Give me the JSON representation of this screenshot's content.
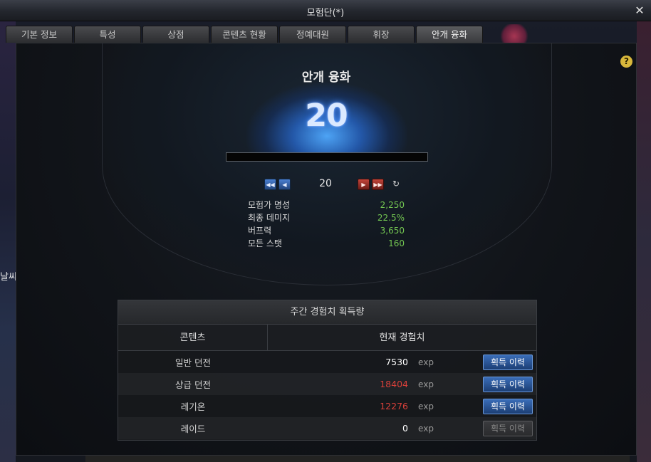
{
  "window": {
    "title": "모험단(*)",
    "close_icon": "close-icon"
  },
  "tabs": [
    {
      "label": "기본 정보",
      "active": false
    },
    {
      "label": "특성",
      "active": false
    },
    {
      "label": "상점",
      "active": false
    },
    {
      "label": "콘텐츠 현황",
      "active": false
    },
    {
      "label": "정예대원",
      "active": false
    },
    {
      "label": "휘장",
      "active": false
    },
    {
      "label": "안개 융화",
      "active": true
    }
  ],
  "help": {
    "icon": "help-icon",
    "label": "?"
  },
  "fusion": {
    "title": "안개 융화",
    "level": "20",
    "progress_fraction": 0.0,
    "nav_level": "20"
  },
  "nav_buttons": {
    "first": "◀◀",
    "prev": "◀",
    "next": "▶",
    "last": "▶▶",
    "refresh": "↻"
  },
  "stats": [
    {
      "label": "모험가 명성",
      "value": "2,250"
    },
    {
      "label": "최종 데미지",
      "value": "22.5%"
    },
    {
      "label": "버프력",
      "value": "3,650"
    },
    {
      "label": "모든 스탯",
      "value": "160"
    }
  ],
  "weekly_exp": {
    "title": "주간 경험치 획득량",
    "col_content": "콘텐츠",
    "col_current": "현재 경험치",
    "rows": [
      {
        "name": "일반 던전",
        "value": "7530",
        "unit": "exp",
        "button": "획득 이력",
        "value_color": "#ffffff",
        "enabled": true
      },
      {
        "name": "상급 던전",
        "value": "18404",
        "unit": "exp",
        "button": "획득 이력",
        "value_color": "#d8403a",
        "enabled": true
      },
      {
        "name": "레기온",
        "value": "12276",
        "unit": "exp",
        "button": "획득 이력",
        "value_color": "#d8403a",
        "enabled": true
      },
      {
        "name": "레이드",
        "value": "0",
        "unit": "exp",
        "button": "획득 이력",
        "value_color": "#ffffff",
        "enabled": false
      }
    ]
  },
  "background": {
    "left_text": "날씨"
  }
}
